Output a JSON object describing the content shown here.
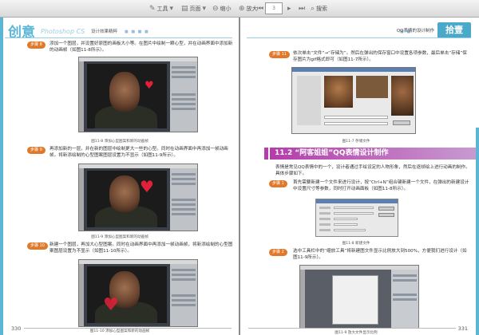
{
  "toolbar": {
    "tools_label": "工具",
    "page_label": "页面",
    "zoom_out_label": "缩小",
    "zoom_in_label": "放大",
    "page_field": "3",
    "search_label": "搜索",
    "icons": [
      "tools-icon",
      "page-icon",
      "zoom-out-icon",
      "zoom-in-icon",
      "first-page-icon",
      "prev-page-icon",
      "next-page-icon",
      "last-page-icon",
      "search-icon"
    ]
  },
  "left_page": {
    "logo_main": "创意",
    "logo_sub": "Photoshop CS",
    "logo_tail": "设计效果精粹",
    "steps": [
      {
        "badge": "步骤 8",
        "text": "添加一个图层，并设置好原图的画板大小等。在图片中绘制一颗心型，并在动画界面中添加新的动画帧（如图11-8所示）。"
      },
      {
        "badge": "步骤 9",
        "text": "再添加新的一层，并在新的图层中绘制更大一些的心型。同时在动画界面中再添加一帧动画帧。将新添绘制的心型图案图层设置为不显示（如图11-9所示）。"
      },
      {
        "badge": "步骤 10",
        "text": "新建一个图层，再加大心型图案。同时在动画界面中再添加一帧动画帧，将新添绘制的心型图案图层设置为不显示（如图11-10所示）。"
      }
    ],
    "captions": [
      "图11-8 添加心型图案和新的动画帧",
      "图11-9 添加心型图案和新的动画帧",
      "图11-10 添加心型图案和新的动画帧"
    ],
    "page_number": "330"
  },
  "right_page": {
    "header_title": "QQ表情的设计制作",
    "tag": "拾壹",
    "step11": {
      "badge": "步骤 11",
      "text": "依次单击“文件”→“存储为”。然后在弹出的保存窗口中设置各项参数，最后单击“存储”保存图片为gif格式即可（如图11-7所示）。"
    },
    "caption_top": "图11-7 存储文件",
    "section_title": "11.2  “阿客姐姐”QQ表情设计制作",
    "intro": "表情是常见QQ表情中的一个，设计者通过手绘设定的人物形象，然后在逐帧绘上进行动画的制作。具体步骤如下。",
    "step1": {
      "badge": "步骤 1",
      "text": "首先需要新建一个文件来进行设计，按“Ctrl+N”组合键新建一个文件，在弹出的新建设计中设置尺寸等参数，同时打开动画面板（如图11-8所示）。"
    },
    "caption_mid": "图11-8 新建文件",
    "step2": {
      "badge": "步骤 2",
      "text": "选中工具栏中的“缩放工具”将新建图文件显示比例放大到500%，方便我们进行设计（如图11-9所示）。"
    },
    "caption_bottom": "图11-9 放大文件显示比例",
    "page_number": "331"
  },
  "colors": {
    "accent_blue": "#5bb6d6",
    "step_orange": "#e07a2a",
    "section_purple": "#b53cab",
    "heart_red": "#e2203a"
  }
}
